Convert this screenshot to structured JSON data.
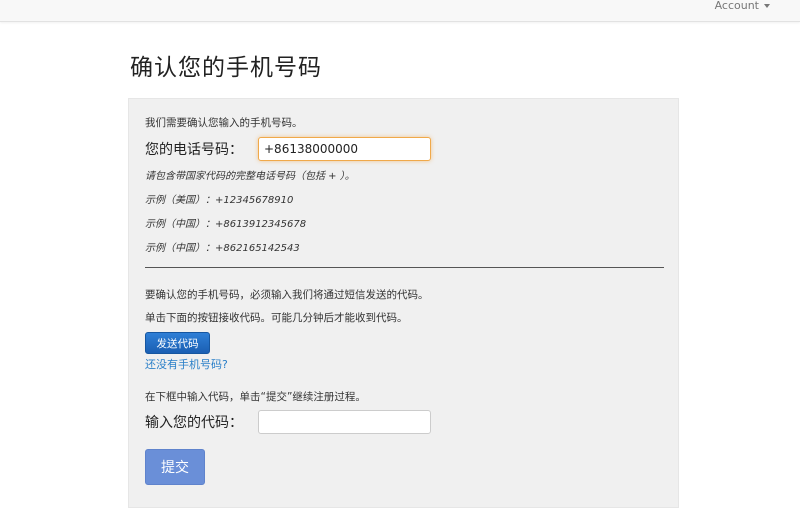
{
  "navbar": {
    "account_label": "Account"
  },
  "page": {
    "title": "确认您的手机号码"
  },
  "form": {
    "intro": "我们需要确认您输入的手机号码。",
    "phone_label": "您的电话号码：",
    "phone_value": "+86138000000",
    "hint_country_code": "请包含带国家代码的完整电话号码（包括 + ）。",
    "example_us": "示例（美国）：+12345678910",
    "example_cn_1": "示例（中国）：+8613912345678",
    "example_cn_2": "示例（中国）：+862165142543",
    "confirm_text": "要确认您的手机号码，必须输入我们将通过短信发送的代码。",
    "click_text": "单击下面的按钮接收代码。可能几分钟后才能收到代码。",
    "send_button": "发送代码",
    "no_phone_link": "还没有手机号码?",
    "enter_code_text": "在下框中输入代码，单击“提交”继续注册过程。",
    "code_label": "输入您的代码：",
    "code_value": "",
    "submit_button": "提交"
  }
}
